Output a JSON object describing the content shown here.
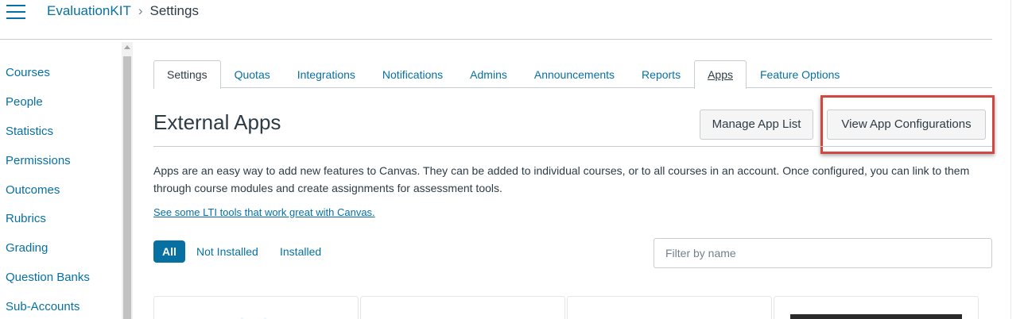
{
  "header": {
    "breadcrumb": {
      "account": "EvaluationKIT",
      "separator": "›",
      "current": "Settings"
    }
  },
  "sidebar": {
    "items": [
      {
        "label": "Courses"
      },
      {
        "label": "People"
      },
      {
        "label": "Statistics"
      },
      {
        "label": "Permissions"
      },
      {
        "label": "Outcomes"
      },
      {
        "label": "Rubrics"
      },
      {
        "label": "Grading"
      },
      {
        "label": "Question Banks"
      },
      {
        "label": "Sub-Accounts"
      }
    ]
  },
  "tabs": [
    {
      "label": "Settings"
    },
    {
      "label": "Quotas"
    },
    {
      "label": "Integrations"
    },
    {
      "label": "Notifications"
    },
    {
      "label": "Admins"
    },
    {
      "label": "Announcements"
    },
    {
      "label": "Reports"
    },
    {
      "label": "Apps"
    },
    {
      "label": "Feature Options"
    }
  ],
  "main": {
    "title": "External Apps",
    "manage_button": "Manage App List",
    "view_button": "View App Configurations",
    "description": "Apps are an easy way to add new features to Canvas. They can be added to individual courses, or to all courses in an account. Once configured, you can link to them through course modules and create assignments for assessment tools.",
    "lti_link": "See some LTI tools that work great with Canvas.",
    "filters": {
      "all": "All",
      "not_installed": "Not Installed",
      "installed": "Installed"
    },
    "filter_placeholder": "Filter by name"
  },
  "colors": {
    "link": "#0770a3",
    "text": "#2d3b45",
    "highlight_box": "#d0483f"
  }
}
